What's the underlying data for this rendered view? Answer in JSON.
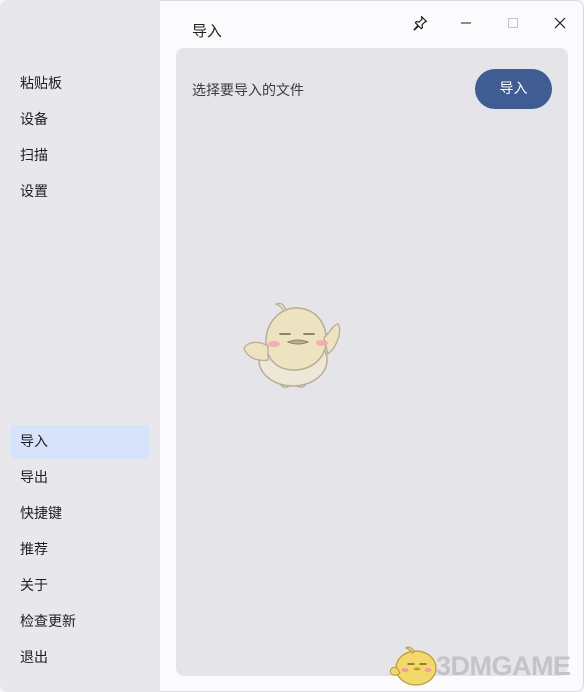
{
  "sidebar": {
    "top_items": [
      {
        "label": "粘贴板"
      },
      {
        "label": "设备"
      },
      {
        "label": "扫描"
      },
      {
        "label": "设置"
      }
    ],
    "bottom_items": [
      {
        "label": "导入",
        "active": true
      },
      {
        "label": "导出"
      },
      {
        "label": "快捷键"
      },
      {
        "label": "推荐"
      },
      {
        "label": "关于"
      },
      {
        "label": "检查更新"
      },
      {
        "label": "退出"
      }
    ]
  },
  "titlebar": {
    "title": "导入",
    "buttons": [
      "pin-icon",
      "minimize-icon",
      "maximize-icon",
      "close-icon"
    ]
  },
  "main": {
    "prompt_text": "选择要导入的文件",
    "import_button_label": "导入",
    "accent_color": "#3f5d93"
  },
  "watermark": {
    "text": "3DMGAME"
  }
}
